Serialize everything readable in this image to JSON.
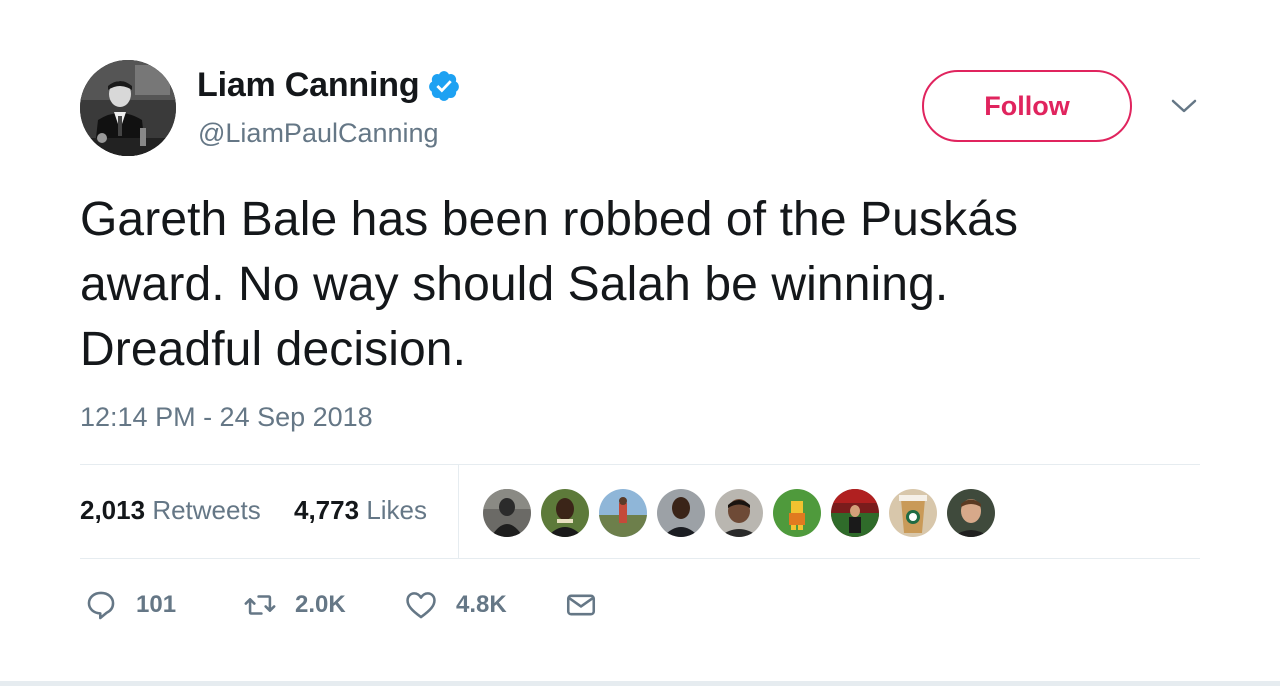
{
  "user": {
    "display_name": "Liam Canning",
    "handle": "@LiamPaulCanning",
    "verified_icon": "verified-badge-icon"
  },
  "follow_label": "Follow",
  "tweet": {
    "lines": [
      "Gareth Bale has been robbed of the Puskás",
      "award. No way should Salah be winning.",
      "Dreadful decision."
    ],
    "timestamp": "12:14 PM - 24 Sep 2018"
  },
  "stats": {
    "retweets_count": "2,013",
    "retweets_label": "Retweets",
    "likes_count": "4,773",
    "likes_label": "Likes"
  },
  "actions": {
    "reply_count": "101",
    "retweet_count": "2.0K",
    "like_count": "4.8K"
  },
  "colors": {
    "accent": "#e0245e",
    "verified": "#1da1f2",
    "secondary_text": "#657786",
    "divider": "#e6ecf0"
  }
}
